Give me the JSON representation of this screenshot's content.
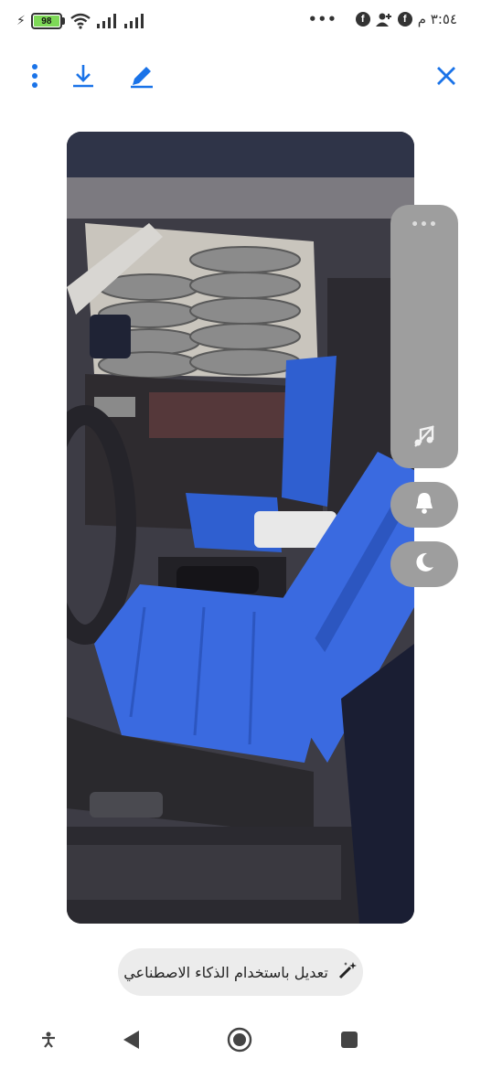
{
  "status_bar": {
    "battery_level": "98",
    "time": "٣:٥٤ م",
    "more_dots": "•••",
    "notification_icons": [
      "facebook-icon",
      "person-add-icon",
      "facebook-icon"
    ]
  },
  "toolbar": {
    "icons": [
      "more-vertical-icon",
      "download-icon",
      "edit-pencil-icon",
      "close-icon"
    ],
    "accent_color": "#1a73e8"
  },
  "photo": {
    "subject": "car-interior-blue-seat-covers"
  },
  "side_panel": {
    "more_label": "•••",
    "icons": [
      "music-off-icon",
      "bell-icon",
      "moon-icon"
    ]
  },
  "ai_edit": {
    "label": "تعديل باستخدام الذكاء الاصطناعي",
    "icon": "magic-wand-icon"
  },
  "nav_bar": {
    "icons": [
      "accessibility-icon",
      "back-icon",
      "home-icon",
      "recents-icon"
    ]
  }
}
